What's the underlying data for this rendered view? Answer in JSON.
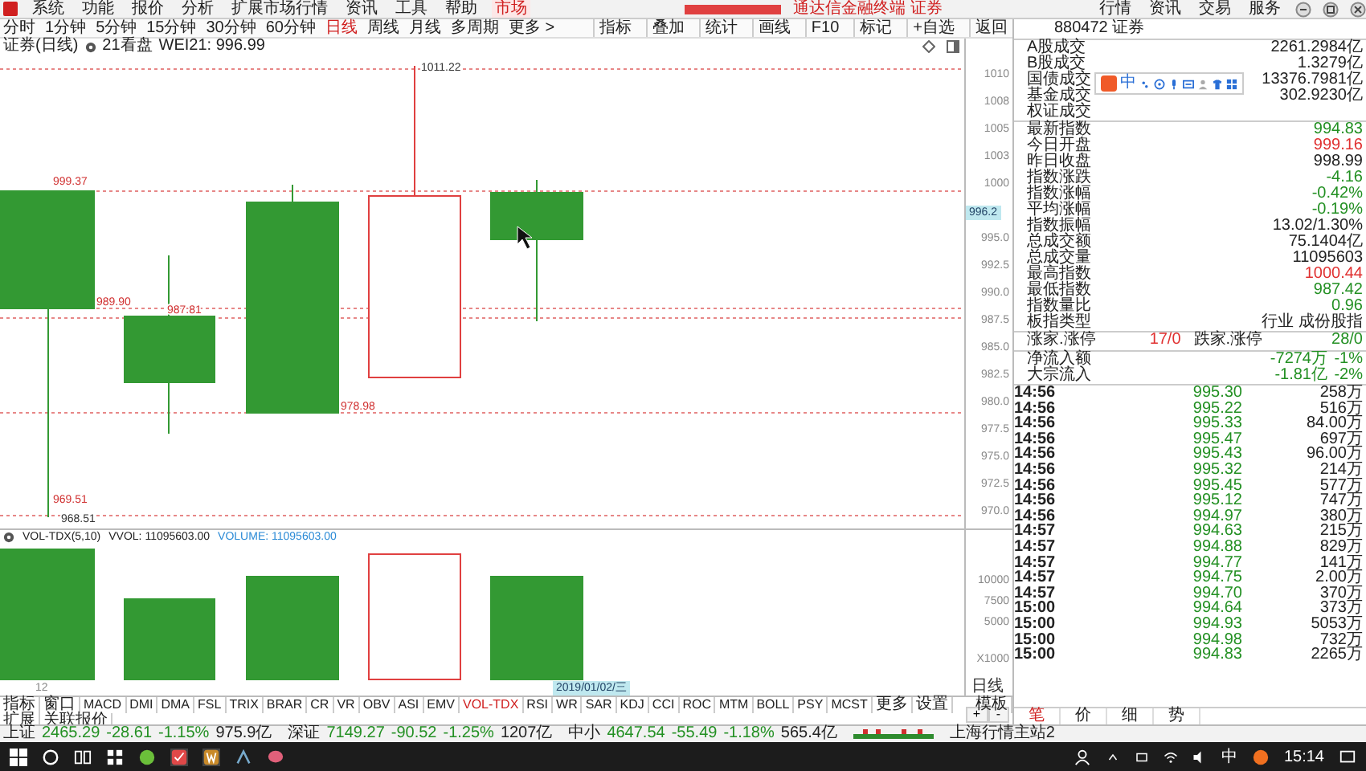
{
  "menu_bar": {
    "items": [
      {
        "label": "系统",
        "selected": false
      },
      {
        "label": "功能",
        "selected": false
      },
      {
        "label": "报价",
        "selected": false
      },
      {
        "label": "分析",
        "selected": false
      },
      {
        "label": "扩展市场行情",
        "selected": false
      },
      {
        "label": "资讯",
        "selected": false
      },
      {
        "label": "工具",
        "selected": false
      },
      {
        "label": "帮助",
        "selected": false
      },
      {
        "label": "市场",
        "selected": true
      }
    ],
    "title": "通达信金融终端 证券",
    "right_items": [
      "行情",
      "资讯",
      "交易",
      "服务"
    ]
  },
  "period_tabs": [
    {
      "label": "分时",
      "selected": false
    },
    {
      "label": "1分钟",
      "selected": false
    },
    {
      "label": "5分钟",
      "selected": false
    },
    {
      "label": "15分钟",
      "selected": false
    },
    {
      "label": "30分钟",
      "selected": false
    },
    {
      "label": "60分钟",
      "selected": false
    },
    {
      "label": "日线",
      "selected": true
    },
    {
      "label": "周线",
      "selected": false
    },
    {
      "label": "月线",
      "selected": false
    },
    {
      "label": "多周期",
      "selected": false
    },
    {
      "label": "更多 >",
      "selected": false
    }
  ],
  "chart_tools": [
    "指标",
    "叠加",
    "统计",
    "画线",
    "F10",
    "标记",
    "+自选",
    "返回"
  ],
  "price_chart": {
    "title": "证券(日线)",
    "view": "21看盘",
    "indicator": "WEI21: 996.99",
    "axis_ticks": [
      "1010",
      "1008",
      "1005",
      "1003",
      "1000",
      "995.0",
      "992.5",
      "990.0",
      "987.5",
      "985.0",
      "982.5",
      "980.0",
      "977.5",
      "975.0",
      "972.5",
      "970.0"
    ],
    "current_price": "996.2",
    "price_labels": [
      "999.37",
      "989.90",
      "987.81",
      "978.98",
      "969.51",
      "968.51",
      "1011.22"
    ],
    "candles": [
      {
        "kind": "down"
      },
      {
        "kind": "down"
      },
      {
        "kind": "down"
      },
      {
        "kind": "up"
      },
      {
        "kind": "down"
      }
    ]
  },
  "volume_chart": {
    "name": "VOL-TDX(5,10)",
    "vvol": "VVOL: 11095603.00",
    "volume": "VOLUME: 11095603.00",
    "axis_ticks": [
      "10000",
      "7500",
      "5000"
    ],
    "axis_unit": "X1000",
    "date_label": "2019/01/02/三",
    "left_label": "12"
  },
  "period_label": "日线",
  "zoom_buttons": [
    "+",
    "-"
  ],
  "indicator_tabs": [
    {
      "label": "指标",
      "selected": false
    },
    {
      "label": "窗口",
      "selected": false
    },
    {
      "label": "MACD",
      "selected": false
    },
    {
      "label": "DMI",
      "selected": false
    },
    {
      "label": "DMA",
      "selected": false
    },
    {
      "label": "FSL",
      "selected": false
    },
    {
      "label": "TRIX",
      "selected": false
    },
    {
      "label": "BRAR",
      "selected": false
    },
    {
      "label": "CR",
      "selected": false
    },
    {
      "label": "VR",
      "selected": false
    },
    {
      "label": "OBV",
      "selected": false
    },
    {
      "label": "ASI",
      "selected": false
    },
    {
      "label": "EMV",
      "selected": false
    },
    {
      "label": "VOL-TDX",
      "selected": true
    },
    {
      "label": "RSI",
      "selected": false
    },
    {
      "label": "WR",
      "selected": false
    },
    {
      "label": "SAR",
      "selected": false
    },
    {
      "label": "KDJ",
      "selected": false
    },
    {
      "label": "CCI",
      "selected": false
    },
    {
      "label": "ROC",
      "selected": false
    },
    {
      "label": "MTM",
      "selected": false
    },
    {
      "label": "BOLL",
      "selected": false
    },
    {
      "label": "PSY",
      "selected": false
    },
    {
      "label": "MCST",
      "selected": false
    },
    {
      "label": "更多",
      "selected": false
    },
    {
      "label": "设置",
      "selected": false
    }
  ],
  "template_button": "模板",
  "extra_tabs": [
    "扩展",
    "关联报价"
  ],
  "status_bar": {
    "indices": [
      {
        "name": "上证",
        "value": "2465.29",
        "change": "-28.61",
        "percent": "-1.15%",
        "amount": "975.9亿"
      },
      {
        "name": "深证",
        "value": "7149.27",
        "change": "-90.52",
        "percent": "-1.25%",
        "amount": "1207亿"
      },
      {
        "name": "中小",
        "value": "4647.54",
        "change": "-55.49",
        "percent": "-1.18%",
        "amount": "565.4亿"
      }
    ],
    "server": "上海行情主站2"
  },
  "quote_panel": {
    "code": "880472",
    "name": "证券",
    "turnover": [
      {
        "label": "A股成交",
        "value": "2261.2984亿"
      },
      {
        "label": "B股成交",
        "value": "1.3279亿"
      },
      {
        "label": "国债成交",
        "value": "13376.7981亿"
      },
      {
        "label": "基金成交",
        "value": "302.9230亿"
      },
      {
        "label": "权证成交"
      }
    ],
    "stats": [
      {
        "label": "最新指数",
        "value": "994.83",
        "color": "#239023"
      },
      {
        "label": "今日开盘",
        "value": "999.16",
        "color": "#e03030"
      },
      {
        "label": "昨日收盘",
        "value": "998.99",
        "color": "#222222"
      },
      {
        "label": "指数涨跌",
        "value": "-4.16",
        "color": "#239023"
      },
      {
        "label": "指数涨幅",
        "value": "-0.42%",
        "color": "#239023"
      },
      {
        "label": "平均涨幅",
        "value": "-0.19%",
        "color": "#239023"
      },
      {
        "label": "指数振幅",
        "value": "13.02/1.30%",
        "color": "#222222"
      },
      {
        "label": "总成交额",
        "value": "75.1404亿",
        "color": "#222222"
      },
      {
        "label": "总成交量",
        "value": "11095603",
        "color": "#222222"
      },
      {
        "label": "最高指数",
        "value": "1000.44",
        "color": "#e03030"
      },
      {
        "label": "最低指数",
        "value": "987.42",
        "color": "#239023"
      },
      {
        "label": "指数量比",
        "value": "0.96",
        "color": "#239023"
      },
      {
        "label": "板指类型",
        "value": "行业 成份股指",
        "color": "#222222"
      }
    ],
    "breadth": {
      "up_label": "涨家.涨停",
      "up_value": "17/0",
      "down_label": "跌家.涨停",
      "down_value": "28/0"
    },
    "flows": [
      {
        "label": "净流入额",
        "value": "-7274万",
        "percent": "-1%"
      },
      {
        "label": "大宗流入",
        "value": "-1.81亿",
        "percent": "-2%"
      }
    ],
    "ticks": [
      {
        "time": "14:56",
        "price": "995.30",
        "volume": "258万"
      },
      {
        "time": "14:56",
        "price": "995.22",
        "volume": "516万"
      },
      {
        "time": "14:56",
        "price": "995.33",
        "volume": "84.00万"
      },
      {
        "time": "14:56",
        "price": "995.47",
        "volume": "697万"
      },
      {
        "time": "14:56",
        "price": "995.43",
        "volume": "96.00万"
      },
      {
        "time": "14:56",
        "price": "995.32",
        "volume": "214万"
      },
      {
        "time": "14:56",
        "price": "995.45",
        "volume": "577万"
      },
      {
        "time": "14:56",
        "price": "995.12",
        "volume": "747万"
      },
      {
        "time": "14:56",
        "price": "994.97",
        "volume": "380万"
      },
      {
        "time": "14:57",
        "price": "994.63",
        "volume": "215万"
      },
      {
        "time": "14:57",
        "price": "994.88",
        "volume": "829万"
      },
      {
        "time": "14:57",
        "price": "994.77",
        "volume": "141万"
      },
      {
        "time": "14:57",
        "price": "994.75",
        "volume": "2.00万"
      },
      {
        "time": "14:57",
        "price": "994.70",
        "volume": "370万"
      },
      {
        "time": "15:00",
        "price": "994.64",
        "volume": "373万"
      },
      {
        "time": "15:00",
        "price": "994.93",
        "volume": "5053万"
      },
      {
        "time": "15:00",
        "price": "994.98",
        "volume": "732万"
      },
      {
        "time": "15:00",
        "price": "994.83",
        "volume": "2265万"
      }
    ],
    "detail_tabs": [
      {
        "label": "笔",
        "selected": true
      },
      {
        "label": "价",
        "selected": false
      },
      {
        "label": "细",
        "selected": false
      },
      {
        "label": "势",
        "selected": false
      }
    ]
  },
  "ime_toolbar": {
    "mode": "中"
  },
  "taskbar": {
    "input_mode": "中",
    "time": "15:14"
  }
}
